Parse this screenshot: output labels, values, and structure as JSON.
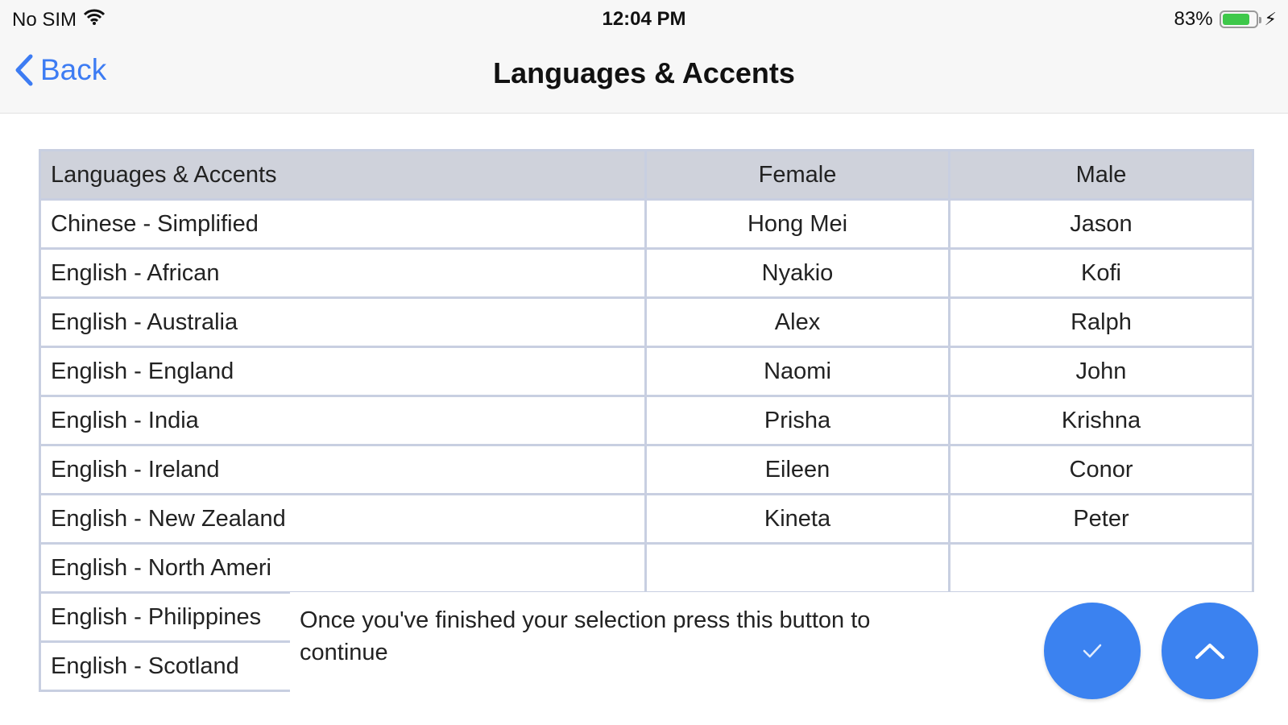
{
  "status": {
    "carrier": "No SIM",
    "time": "12:04 PM",
    "battery_percent": "83%",
    "battery_level": 0.83,
    "battery_color": "#3ec84a"
  },
  "nav": {
    "back_label": "Back",
    "title": "Languages & Accents",
    "accent_color": "#3d7cf3"
  },
  "table": {
    "headers": [
      "Languages & Accents",
      "Female",
      "Male"
    ],
    "rows": [
      [
        "Chinese - Simplified",
        "Hong Mei",
        "Jason"
      ],
      [
        "English - African",
        "Nyakio",
        "Kofi"
      ],
      [
        "English - Australia",
        "Alex",
        "Ralph"
      ],
      [
        "English - England",
        "Naomi",
        "John"
      ],
      [
        "English - India",
        "Prisha",
        "Krishna"
      ],
      [
        "English - Ireland",
        "Eileen",
        "Conor"
      ],
      [
        "English - New Zealand",
        "Kineta",
        "Peter"
      ],
      [
        "English - North Ameri",
        "",
        ""
      ],
      [
        "English - Philippines",
        "",
        ""
      ],
      [
        "English - Scotland",
        "",
        ""
      ]
    ]
  },
  "hint": {
    "text": "Once you've finished your selection press this button to continue"
  },
  "buttons": {
    "confirm_icon": "checkmark-icon",
    "up_icon": "chevron-up-icon",
    "color": "#3b82f0"
  }
}
